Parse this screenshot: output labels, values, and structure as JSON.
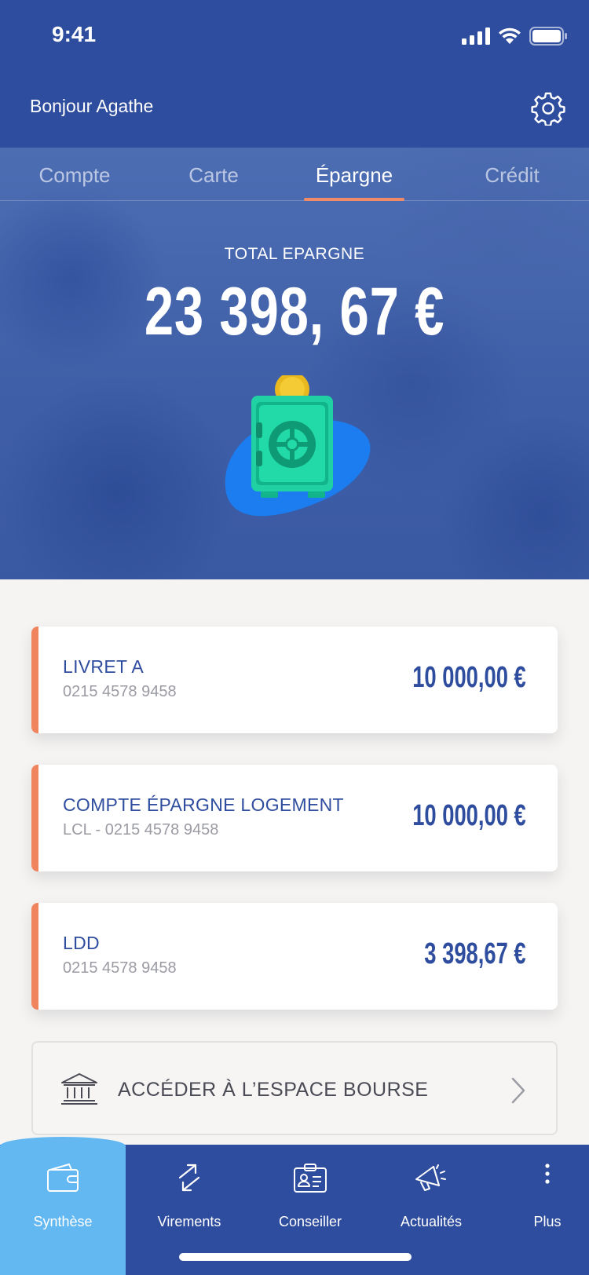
{
  "status_bar": {
    "time": "9:41"
  },
  "header": {
    "greeting": "Bonjour Agathe"
  },
  "tabs": [
    {
      "label": "Compte",
      "active": false
    },
    {
      "label": "Carte",
      "active": false
    },
    {
      "label": "Épargne",
      "active": true
    },
    {
      "label": "Crédit",
      "active": false
    }
  ],
  "summary": {
    "label": "TOTAL EPARGNE",
    "amount": "23 398, 67 €"
  },
  "accounts": [
    {
      "name": "LIVRET A",
      "number": "0215 4578 9458",
      "amount": "10 000,00 €"
    },
    {
      "name": "COMPTE ÉPARGNE LOGEMENT",
      "number": "LCL - 0215 4578 9458",
      "amount": "10 000,00 €"
    },
    {
      "name": "LDD",
      "number": "0215 4578 9458",
      "amount": "3 398,67 €"
    }
  ],
  "bourse": {
    "label": "ACCÉDER À L’ESPACE BOURSE"
  },
  "bottom_nav": [
    {
      "label": "Synthèse",
      "icon": "wallet-icon",
      "active": true
    },
    {
      "label": "Virements",
      "icon": "transfer-arrows-icon",
      "active": false
    },
    {
      "label": "Conseiller",
      "icon": "id-card-icon",
      "active": false
    },
    {
      "label": "Actualités",
      "icon": "megaphone-icon",
      "active": false
    },
    {
      "label": "Plus",
      "icon": "more-vertical-icon",
      "active": false
    }
  ],
  "colors": {
    "brand_blue": "#2f4d9e",
    "accent_orange": "#f0845f",
    "nav_active": "#63b8f2"
  }
}
